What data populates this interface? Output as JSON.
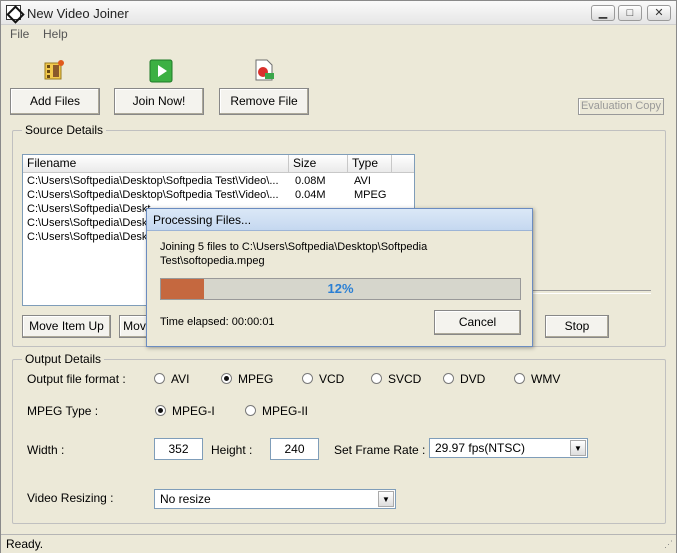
{
  "window": {
    "title": "New Video Joiner"
  },
  "menu": [
    "File",
    "Help"
  ],
  "toolbar": {
    "add_files": "Add Files",
    "join_now": "Join Now!",
    "remove_file": "Remove File",
    "evaluation": "Evaluation Copy"
  },
  "source": {
    "legend": "Source Details",
    "columns": [
      "Filename",
      "Size",
      "Type"
    ],
    "rows": [
      {
        "filename": "C:\\Users\\Softpedia\\Desktop\\Softpedia Test\\Video\\...",
        "size": "0.08M",
        "type": "AVI"
      },
      {
        "filename": "C:\\Users\\Softpedia\\Desktop\\Softpedia Test\\Video\\...",
        "size": "0.04M",
        "type": "MPEG"
      },
      {
        "filename": "C:\\Users\\Softpedia\\Deskt",
        "size": "",
        "type": ""
      },
      {
        "filename": "C:\\Users\\Softpedia\\Deskt",
        "size": "",
        "type": ""
      },
      {
        "filename": "C:\\Users\\Softpedia\\Deskt",
        "size": "",
        "type": ""
      }
    ],
    "move_up": "Move Item Up",
    "move_down": "Mov",
    "stop": "Stop"
  },
  "output": {
    "legend": "Output Details",
    "format_label": "Output file format :",
    "formats": [
      "AVI",
      "MPEG",
      "VCD",
      "SVCD",
      "DVD",
      "WMV"
    ],
    "selected_format": "MPEG",
    "mpeg_type_label": "MPEG Type :",
    "mpeg_types": [
      "MPEG-I",
      "MPEG-II"
    ],
    "selected_mpeg_type": "MPEG-I",
    "width_label": "Width  :",
    "width": "352",
    "height_label": "Height :",
    "height": "240",
    "frame_rate_label": "Set Frame Rate :",
    "frame_rate": "29.97 fps(NTSC)",
    "resizing_label": "Video Resizing :",
    "resizing": "No resize"
  },
  "status": {
    "text": "Ready."
  },
  "dialog": {
    "title": "Processing Files...",
    "message_line1": "Joining 5 files to C:\\Users\\Softpedia\\Desktop\\Softpedia",
    "message_line2": "Test\\softopedia.mpeg",
    "progress": 12,
    "progress_text": "12%",
    "elapsed": "Time elapsed: 00:00:01",
    "cancel": "Cancel"
  },
  "colors": {
    "progress_fill": "#c5683f",
    "progress_text": "#2a7fd4"
  },
  "icons": [
    "app-icon",
    "add-files-icon",
    "join-now-icon",
    "remove-file-icon"
  ]
}
